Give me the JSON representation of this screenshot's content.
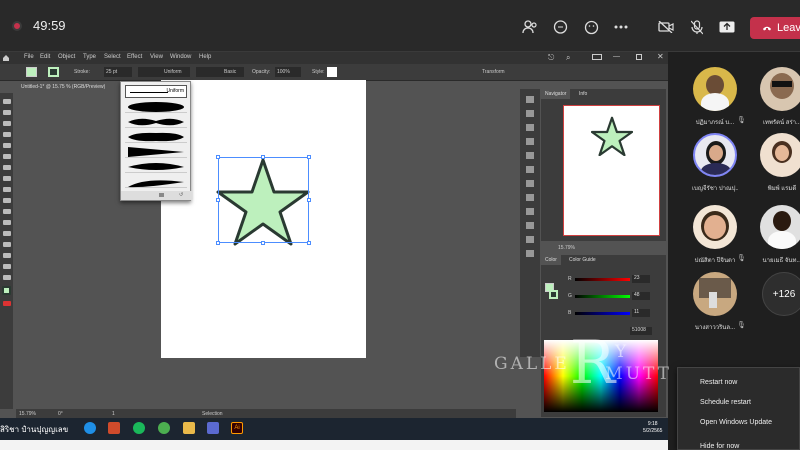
{
  "teams": {
    "timer": "49:59",
    "leave_label": "Leave"
  },
  "illustrator": {
    "menu": [
      "File",
      "Edit",
      "Object",
      "Type",
      "Select",
      "Effect",
      "View",
      "Window",
      "Help"
    ],
    "control": {
      "stroke_label": "Stroke:",
      "stroke_weight": "25 pt",
      "profile_label": "Uniform",
      "brush_label": "Basic",
      "opacity_label": "Opacity:",
      "opacity_value": "100%",
      "style_label": "Style:",
      "transform_label": "Transform"
    },
    "doc_tab": "Untitled-1* @ 15.75 % (RGB/Preview)",
    "profile_popup_top": "Uniform",
    "fill_color": "#bdf0bd",
    "stroke_color": "#2a3a32",
    "status": {
      "zoom": "15.79%",
      "rotation": "0°",
      "page": "1",
      "tool": "Selection"
    },
    "navigator": {
      "tabs": [
        "Navigator",
        "Info"
      ],
      "zoom": "15.79%"
    },
    "color_panel": {
      "tabs": [
        "Color",
        "Color Guide"
      ],
      "r_label": "R",
      "g_label": "G",
      "b_label": "B",
      "r_value": "23",
      "g_value": "48",
      "b_value": "11",
      "hex": "51008"
    }
  },
  "taskbar": {
    "user_text": "สิริชา ปำนปุญญเลข",
    "time": "9:18",
    "date": "5/2/2565"
  },
  "participants": [
    {
      "name": "ปฏิมาภรณ์ บ...",
      "color": "#d9b84a"
    },
    {
      "name": "เทพรัตน์ สร่า...",
      "color": "#6a5040"
    },
    {
      "name": "เบญจีรัชา ปาณปุ...",
      "color": "#3a3a6a"
    },
    {
      "name": "พิมพ์ แรมดี",
      "color": "#c8a080"
    },
    {
      "name": "ปณัสิตา ปีจินดา",
      "color": "#e8c0a0"
    },
    {
      "name": "นายเมธี จันท...",
      "color": "#e0e0e0"
    },
    {
      "name": "นางสาววรินล...",
      "color": "#c8a880"
    }
  ],
  "more_count": "+126",
  "context_menu": [
    "Restart now",
    "Schedule restart",
    "Open Windows Update",
    "Hide for now"
  ],
  "watermark": {
    "left": "GALLE",
    "big": "R",
    "small": "Y",
    "right": "MUTT"
  }
}
